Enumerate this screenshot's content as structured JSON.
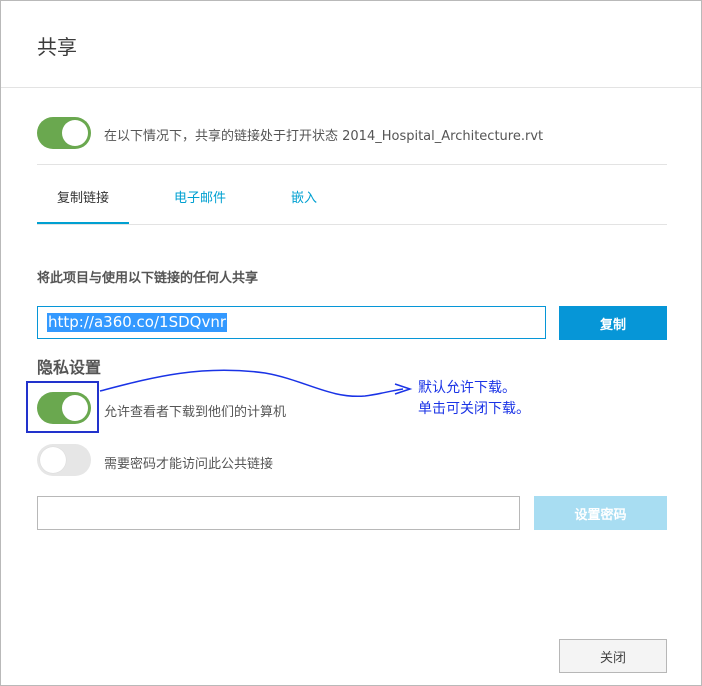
{
  "dialog": {
    "title": "共享",
    "share_toggle": {
      "on": true,
      "label": "在以下情况下，共享的链接处于打开状态 2014_Hospital_Architecture.rvt"
    },
    "tabs": [
      {
        "label": "复制链接",
        "active": true
      },
      {
        "label": "电子邮件",
        "active": false
      },
      {
        "label": "嵌入",
        "active": false
      }
    ],
    "copy_link": {
      "section_label": "将此项目与使用以下链接的任何人共享",
      "link_value": "http://a360.co/1SDQvnr",
      "copy_button": "复制"
    },
    "privacy": {
      "heading": "隐私设置",
      "download_toggle": {
        "on": true,
        "label": "允许查看者下载到他们的计算机"
      },
      "password_toggle": {
        "on": false,
        "label": "需要密码才能访问此公共链接"
      },
      "password_value": "",
      "set_password_button": "设置密码"
    },
    "close_button": "关闭"
  },
  "annotation": {
    "line1": "默认允许下载。",
    "line2": "单击可关闭下载。"
  },
  "colors": {
    "toggle_on": "#6aa84f",
    "toggle_off": "#e6e6e6",
    "accent": "#0696d7",
    "tab_link": "#00a0d1",
    "annotation": "#1a33e6"
  }
}
